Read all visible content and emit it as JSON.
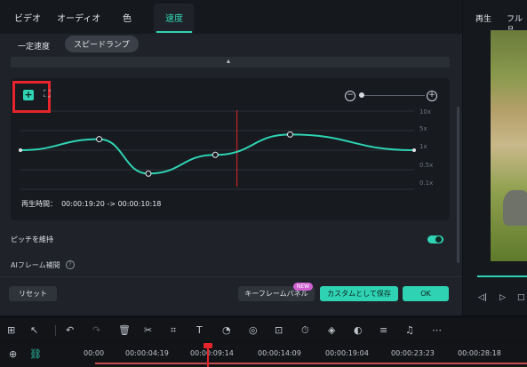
{
  "tabs": [
    "ビデオ",
    "オーディオ",
    "色",
    "速度"
  ],
  "active_tab": "速度",
  "speed_modes": [
    "一定速度",
    "スピードランプ"
  ],
  "selected_mode": "スピードランプ",
  "graph": {
    "y_labels": [
      "10x",
      "5x",
      "1x",
      "0.5x",
      "0.1x"
    ],
    "keyframes": [
      [
        0,
        0.5
      ],
      [
        0.2,
        0.36
      ],
      [
        0.325,
        0.8
      ],
      [
        0.495,
        0.56
      ],
      [
        0.685,
        0.3
      ],
      [
        1,
        0.5
      ]
    ],
    "playhead": 0.55
  },
  "duration_label": "再生時間：",
  "duration_value": "00:00:19:20 -> 00:00:10:18",
  "pitch_label": "ピッチを維持",
  "pitch_on": true,
  "ai_label": "AIフレーム補間",
  "buttons": {
    "reset": "リセット",
    "keyframe_panel": "キーフレームパネル",
    "new_badge": "NEW",
    "save_custom": "カスタムとして保存",
    "ok": "OK"
  },
  "preview_tabs": [
    "再生",
    "フル品"
  ],
  "timeline": [
    "00:00",
    "00:00:04:19",
    "00:00:09:14",
    "00:00:14:09",
    "00:00:19:04",
    "00:00:23:23",
    "00:00:28:18"
  ],
  "colors": {
    "accent": "#2fd3b3",
    "playhead": "#e5242b"
  }
}
